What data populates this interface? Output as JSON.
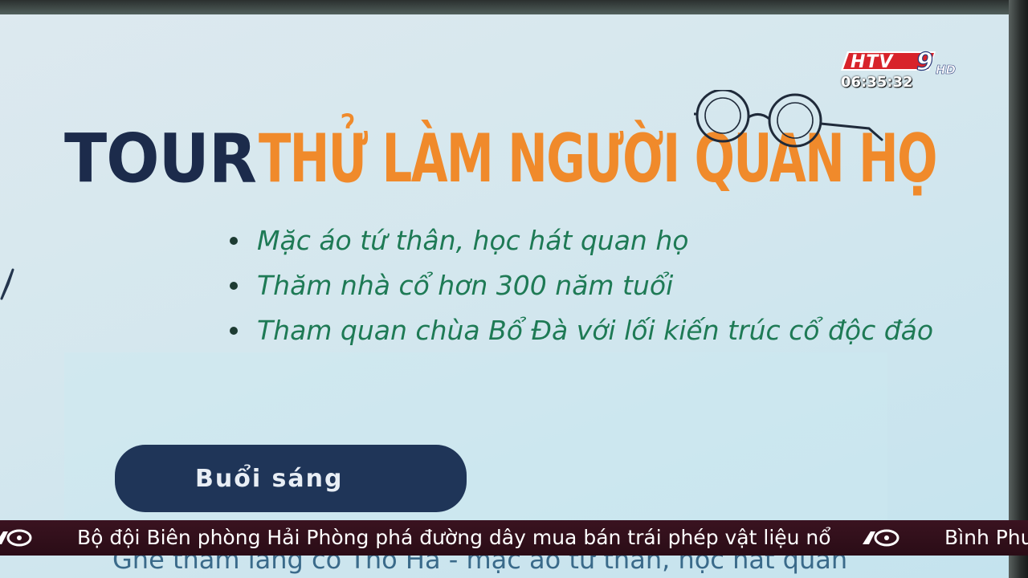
{
  "slide": {
    "tour_label": "TOUR",
    "title": "THỬ LÀM NGƯỜI QUAN HỌ",
    "bullets": [
      "Mặc áo tứ thân, học hát quan họ",
      "Thăm nhà cổ hơn 300 năm tuổi",
      "Tham quan chùa Bổ Đà với lối kiến trúc cổ độc đáo"
    ],
    "morning_button": "Buổi sáng",
    "partial_text": "Ghé thăm làng cổ Thổ Hà - mặc áo tứ thân, học hát quan"
  },
  "channel": {
    "logo_letters": "HTV",
    "logo_number": "9",
    "logo_suffix": "HD",
    "clock": "06:35:32"
  },
  "ticker": {
    "headline": "Bộ đội Biên phòng Hải Phòng phá đường dây mua bán trái phép vật liệu nổ",
    "next_headline": "Bình Phư"
  },
  "colors": {
    "navy": "#1c2b4b",
    "orange": "#f08a2b",
    "green": "#1e7a55",
    "ticker_bg": "#2a0c16"
  }
}
